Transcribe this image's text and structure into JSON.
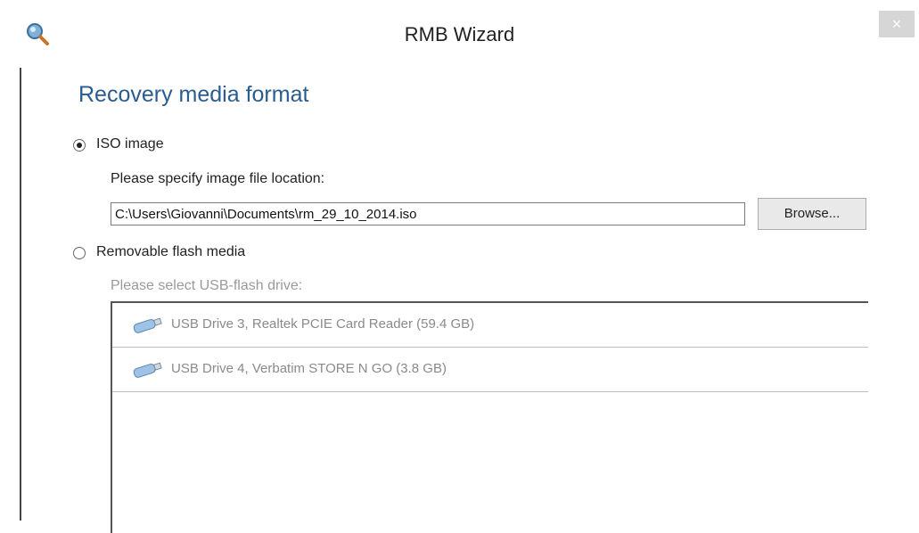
{
  "window": {
    "title": "RMB Wizard",
    "close_label": "×"
  },
  "page": {
    "heading": "Recovery media format"
  },
  "iso_option": {
    "label": "ISO image",
    "selected": true,
    "prompt": "Please specify image file location:",
    "path_value": "C:\\Users\\Giovanni\\Documents\\rm_29_10_2014.iso",
    "browse_label": "Browse..."
  },
  "flash_option": {
    "label": "Removable flash media",
    "selected": false,
    "prompt": "Please select USB-flash drive:",
    "drives": [
      {
        "label": "USB Drive 3, Realtek PCIE Card Reader (59.4 GB)",
        "icon": "usb-drive-icon"
      },
      {
        "label": "USB Drive 4, Verbatim STORE N GO (3.8 GB)",
        "icon": "usb-drive-icon"
      }
    ]
  },
  "colors": {
    "heading": "#2a5d8f",
    "disabled_text": "#9a9a9a"
  }
}
